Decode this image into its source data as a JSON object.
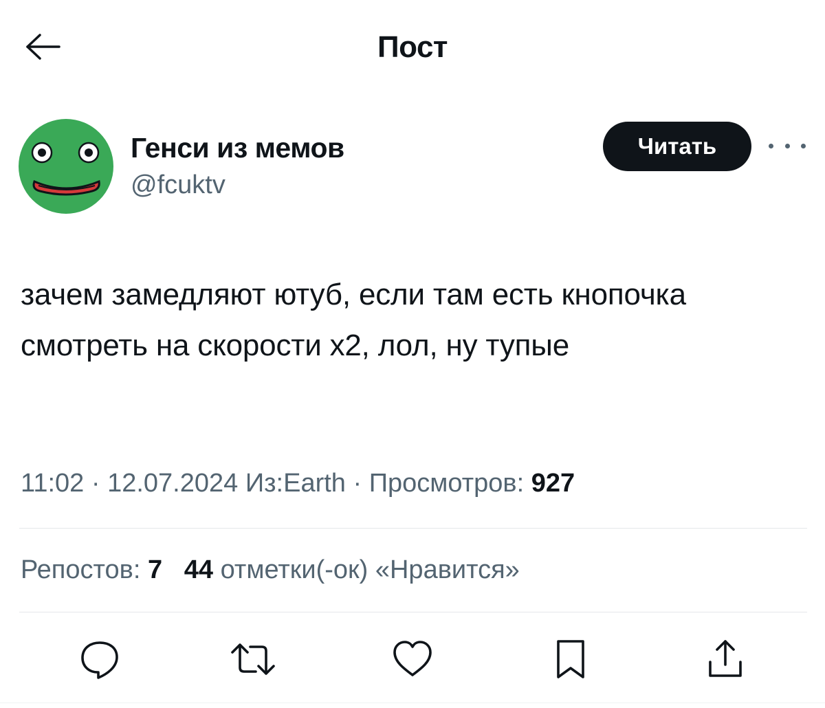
{
  "header": {
    "title": "Пост",
    "back_icon": "arrow-left-icon"
  },
  "author": {
    "name": "Генси из мемов",
    "handle": "@fcuktv",
    "avatar_color": "#3aa957",
    "follow_label": "Читать"
  },
  "post": {
    "text": "зачем замедляют ютуб, если там есть кнопочка смотреть на скорости х2, лол, ну тупые",
    "time": "11:02",
    "separator": "·",
    "date": "12.07.2024",
    "location": "Из:Earth",
    "views_label": "Просмотров:",
    "views_count": "927"
  },
  "stats": {
    "reposts_label": "Репостов:",
    "reposts_count": "7",
    "likes_count": "44",
    "likes_label": "отметки(-ок) «Нравится»"
  },
  "actions": [
    {
      "name": "reply",
      "icon": "speech-bubble-icon"
    },
    {
      "name": "repost",
      "icon": "repost-arrows-icon"
    },
    {
      "name": "like",
      "icon": "heart-icon"
    },
    {
      "name": "bookmark",
      "icon": "bookmark-icon"
    },
    {
      "name": "share",
      "icon": "share-icon"
    }
  ],
  "colors": {
    "text": "#0f1419",
    "secondary": "#536471",
    "button_bg": "#0f1419",
    "button_text": "#ffffff",
    "divider": "#e5e7ea"
  }
}
